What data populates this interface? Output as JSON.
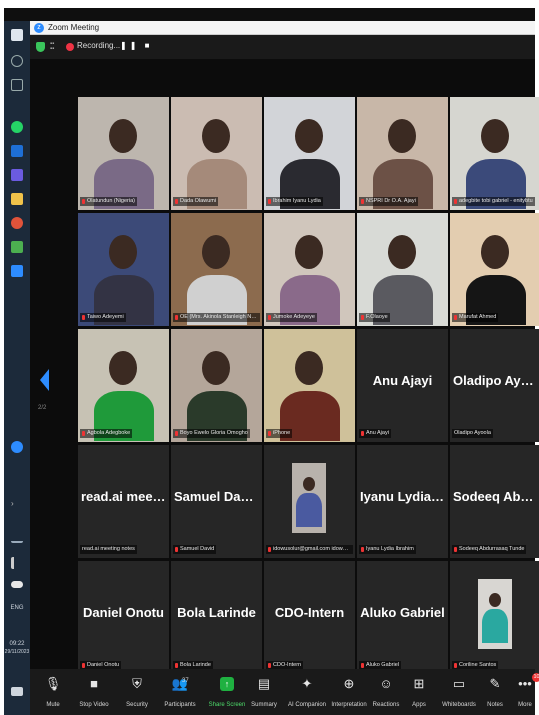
{
  "window": {
    "title": "Zoom Meeting"
  },
  "meeting_bar": {
    "recording_text": "Recording...",
    "pause_stop": "❚❚ ■"
  },
  "taskbar": {
    "lang": "ENG",
    "time": "09:22",
    "date": "29/11/2023"
  },
  "gallery": {
    "page_indicator": "2/2",
    "tiles": [
      {
        "video": true,
        "label": "Olatundun (Nigeria)",
        "muted": true,
        "bg": "#bdb6ae",
        "body": "#7a6a86"
      },
      {
        "video": true,
        "label": "Dada Olawumi",
        "muted": true,
        "bg": "#cbbcb2",
        "body": "#a58a7a"
      },
      {
        "video": true,
        "label": "Ibrahim Iyanu Lydia",
        "muted": true,
        "bg": "#d2d4d8",
        "body": "#2a2a30"
      },
      {
        "video": true,
        "label": "NSPRI Dr O.A. Ajayi",
        "muted": true,
        "bg": "#c8b7a8",
        "body": "#6c5146"
      },
      {
        "video": true,
        "label": "adegbite tobi gabriel - enitybtu",
        "muted": true,
        "bg": "#d6d6d0",
        "body": "#3b4a7a"
      },
      {
        "video": true,
        "label": "Taiwo Adeyemi",
        "muted": true,
        "bg": "#3c4a78",
        "body": "#334"
      },
      {
        "video": true,
        "label": "OE (Mrs. Akinola Stanleigh NSPRI)",
        "muted": true,
        "bg": "#8c6b4e",
        "body": "#d0d0d0"
      },
      {
        "video": true,
        "label": "Jumoke Adeyeye",
        "muted": true,
        "bg": "#d0c6bc",
        "body": "#8a6a8a"
      },
      {
        "video": true,
        "label": "F.Olaoye",
        "muted": true,
        "bg": "#d8dad6",
        "body": "#5a5a60"
      },
      {
        "video": true,
        "label": "Marufat Ahmed",
        "muted": true,
        "bg": "#e3cdb0",
        "body": "#151515"
      },
      {
        "video": true,
        "label": "Agbola Adegboke",
        "muted": true,
        "bg": "#c7c2b4",
        "body": "#1f9a3a"
      },
      {
        "video": true,
        "label": "Boyo Ewelo Gloria Omogho",
        "muted": true,
        "bg": "#b4a69a",
        "body": "#2a3a2a"
      },
      {
        "video": true,
        "label": "iPhone",
        "muted": true,
        "bg": "#cfc19a",
        "body": "#6a2a20"
      },
      {
        "video": false,
        "name": "Anu Ajayi",
        "label": "Anu Ajayi",
        "muted": true
      },
      {
        "video": false,
        "name": "Oladipo Ayoola",
        "label": "Oladipo Ayoola",
        "muted": false
      },
      {
        "video": false,
        "name": "read.ai meeting...",
        "label": "read.ai meeting notes",
        "muted": false
      },
      {
        "video": false,
        "name": "Samuel David",
        "label": "Samuel David",
        "muted": true
      },
      {
        "video": true,
        "label": "idowusolur@gmail.com idowuso...",
        "muted": true,
        "bg": "#b8b2ac",
        "body": "#4a5aa0",
        "small": true
      },
      {
        "video": false,
        "name": "Iyanu Lydia Ibra...",
        "label": "Iyanu Lydia Ibrahim",
        "muted": true
      },
      {
        "video": false,
        "name": "Sodeeq Abdurra...",
        "label": "Sodeeq Abdurrasaq Tunde",
        "muted": true
      },
      {
        "video": false,
        "name": "Daniel Onotu",
        "label": "Daniel Onotu",
        "muted": true
      },
      {
        "video": false,
        "name": "Bola Larinde",
        "label": "Bola Larinde",
        "muted": true
      },
      {
        "video": false,
        "name": "CDO-Intern",
        "label": "CDO-Intern",
        "muted": true
      },
      {
        "video": false,
        "name": "Aluko Gabriel",
        "label": "Aluko Gabriel",
        "muted": true
      },
      {
        "video": true,
        "label": "Coriline Santos",
        "muted": true,
        "bg": "#d8d6d2",
        "body": "#2aa8a0",
        "small": true
      }
    ]
  },
  "controls": {
    "items": [
      {
        "key": "mute",
        "label": "Mute",
        "icon": "🎙"
      },
      {
        "key": "video",
        "label": "Stop Video",
        "icon": "■"
      },
      {
        "key": "security",
        "label": "Security",
        "icon": "⛨"
      },
      {
        "key": "participants",
        "label": "Participants",
        "icon": "👥",
        "count": "37"
      },
      {
        "key": "share",
        "label": "Share Screen",
        "icon": "↑"
      },
      {
        "key": "summary",
        "label": "Summary",
        "icon": "▤"
      },
      {
        "key": "ai",
        "label": "AI Companion",
        "icon": "✦"
      },
      {
        "key": "interpretation",
        "label": "Interpretation",
        "icon": "⊕"
      },
      {
        "key": "reactions",
        "label": "Reactions",
        "icon": "☺"
      },
      {
        "key": "apps",
        "label": "Apps",
        "icon": "⊞"
      },
      {
        "key": "whiteboards",
        "label": "Whiteboards",
        "icon": "▭"
      },
      {
        "key": "notes",
        "label": "Notes",
        "icon": "✎"
      },
      {
        "key": "more",
        "label": "More",
        "icon": "•••",
        "badge": "10"
      }
    ]
  }
}
